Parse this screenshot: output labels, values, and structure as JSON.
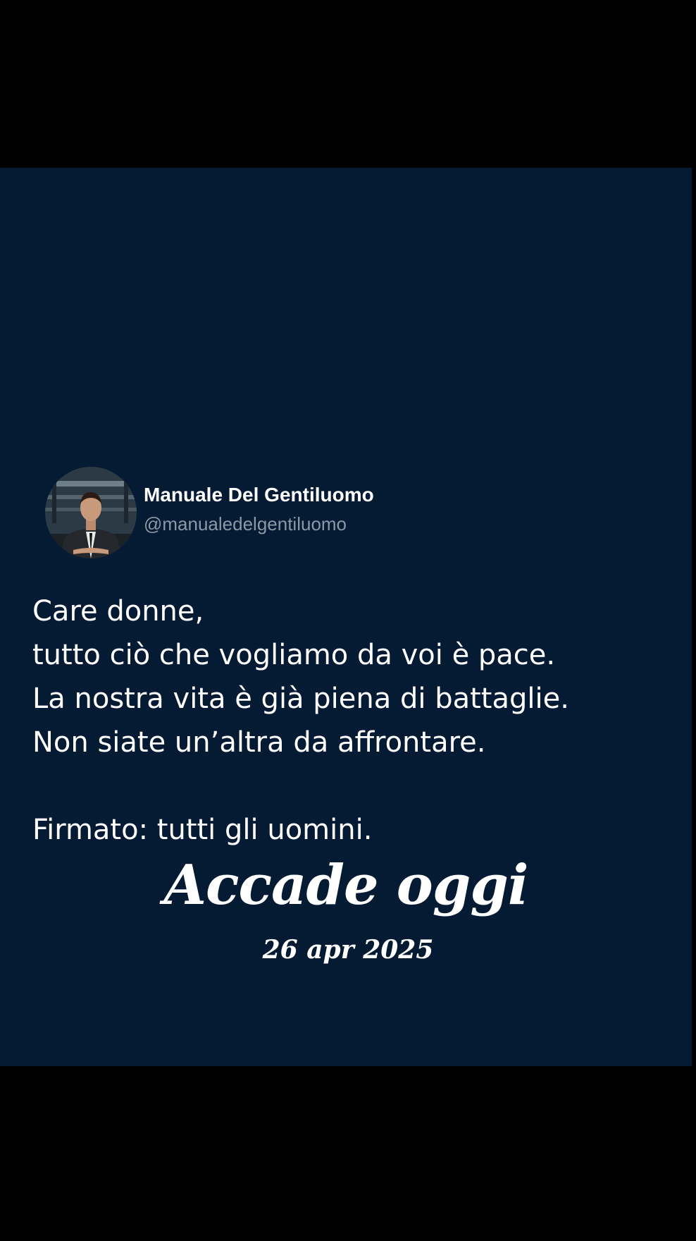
{
  "colors": {
    "page_background": "#000000",
    "panel_background": "#051a33",
    "text_primary": "#ffffff",
    "text_secondary": "#8b98a5"
  },
  "post": {
    "author_name": "Manuale Del Gentiluomo",
    "author_handle": "@manualedelgentiluomo",
    "lines": [
      "Care donne,",
      "tutto ciò che vogliamo da voi è pace.",
      "La nostra vita è già piena di battaglie.",
      "Non siate un’altra da affrontare.",
      "",
      "Firmato: tutti gli uomini."
    ]
  },
  "overlay": {
    "title": "Accade oggi",
    "date": "26 apr 2025"
  }
}
